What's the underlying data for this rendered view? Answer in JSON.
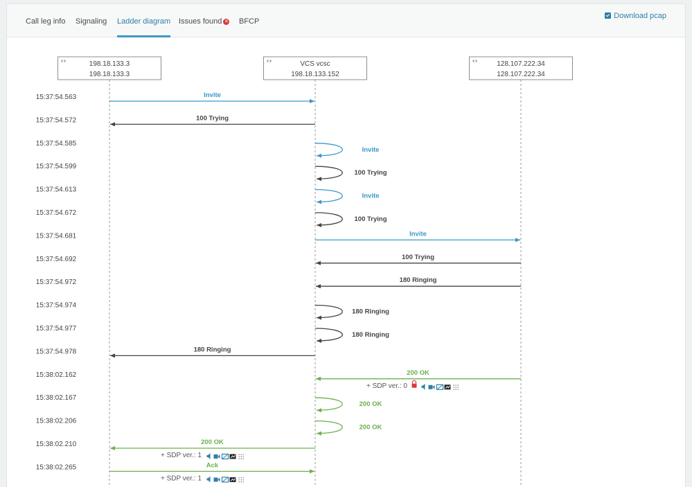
{
  "tabs": [
    {
      "label": "Call leg info",
      "active": false
    },
    {
      "label": "Signaling",
      "active": false
    },
    {
      "label": "Ladder diagram",
      "active": true
    },
    {
      "label": "Issues found",
      "active": false,
      "badge_icon": "error-x-icon"
    },
    {
      "label": "BFCP",
      "active": false
    }
  ],
  "download": {
    "label": "Download pcap",
    "icon": "download-icon"
  },
  "colors": {
    "blue": "#3799c9",
    "dark": "#444444",
    "green": "#6ab04c",
    "red": "#d83a3a"
  },
  "nodes": [
    {
      "line1": "198.18.133.3",
      "line2": "198.18.133.3"
    },
    {
      "line1": "VCS vcsc",
      "line2": "198.18.133.152"
    },
    {
      "line1": "128.107.222.34",
      "line2": "128.107.222.34"
    }
  ],
  "messages": [
    {
      "time": "15:37:54.563",
      "label": "Invite",
      "from": 0,
      "to": 1,
      "color": "blue"
    },
    {
      "time": "15:37:54.572",
      "label": "100 Trying",
      "from": 1,
      "to": 0,
      "color": "dark"
    },
    {
      "time": "15:37:54.585",
      "label": "Invite",
      "from": 1,
      "to": 1,
      "color": "blue"
    },
    {
      "time": "15:37:54.599",
      "label": "100 Trying",
      "from": 1,
      "to": 1,
      "color": "dark"
    },
    {
      "time": "15:37:54.613",
      "label": "Invite",
      "from": 1,
      "to": 1,
      "color": "blue"
    },
    {
      "time": "15:37:54.672",
      "label": "100 Trying",
      "from": 1,
      "to": 1,
      "color": "dark"
    },
    {
      "time": "15:37:54.681",
      "label": "Invite",
      "from": 1,
      "to": 2,
      "color": "blue"
    },
    {
      "time": "15:37:54.692",
      "label": "100 Trying",
      "from": 2,
      "to": 1,
      "color": "dark"
    },
    {
      "time": "15:37:54.972",
      "label": "180 Ringing",
      "from": 2,
      "to": 1,
      "color": "dark"
    },
    {
      "time": "15:37:54.974",
      "label": "180 Ringing",
      "from": 1,
      "to": 1,
      "color": "dark"
    },
    {
      "time": "15:37:54.977",
      "label": "180 Ringing",
      "from": 1,
      "to": 1,
      "color": "dark"
    },
    {
      "time": "15:37:54.978",
      "label": "180 Ringing",
      "from": 1,
      "to": 0,
      "color": "dark"
    },
    {
      "time": "15:38:02.162",
      "label": "200 OK",
      "from": 2,
      "to": 1,
      "color": "green",
      "sdp": "+ SDP ver.: 0",
      "lock": true
    },
    {
      "time": "15:38:02.167",
      "label": "200 OK",
      "from": 1,
      "to": 1,
      "color": "green"
    },
    {
      "time": "15:38:02.206",
      "label": "200 OK",
      "from": 1,
      "to": 1,
      "color": "green"
    },
    {
      "time": "15:38:02.210",
      "label": "200 OK",
      "from": 1,
      "to": 0,
      "color": "green",
      "sdp": "+ SDP ver.: 1",
      "lock": false
    },
    {
      "time": "15:38:02.265",
      "label": "Ack",
      "from": 0,
      "to": 1,
      "color": "green",
      "sdp": "+ SDP ver.: 1",
      "lock": false
    }
  ]
}
